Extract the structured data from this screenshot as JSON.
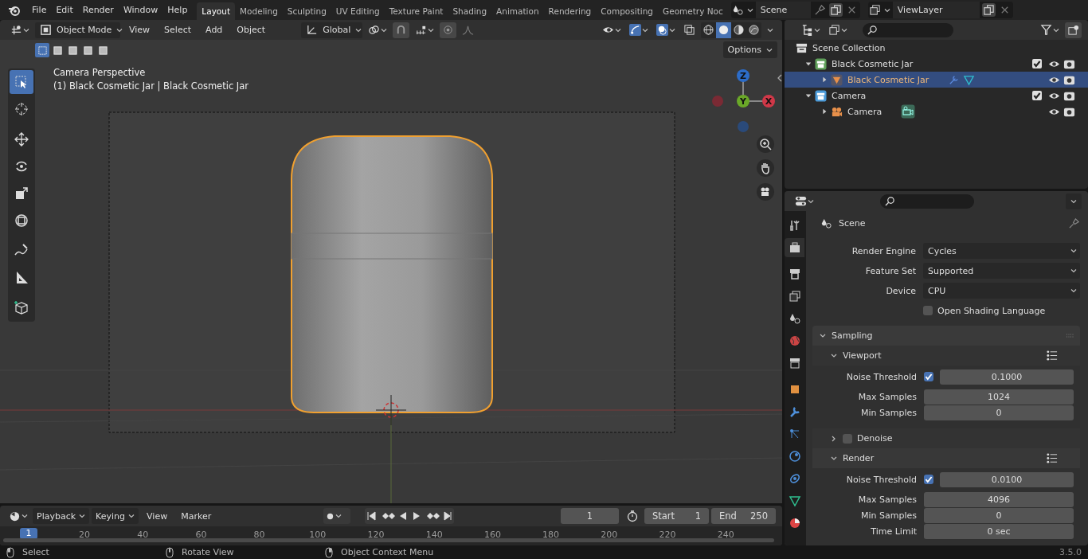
{
  "menu": [
    "File",
    "Edit",
    "Render",
    "Window",
    "Help"
  ],
  "workspaces": [
    {
      "label": "Layout",
      "selected": true
    },
    {
      "label": "Modeling",
      "selected": false
    },
    {
      "label": "Sculpting",
      "selected": false
    },
    {
      "label": "UV Editing",
      "selected": false
    },
    {
      "label": "Texture Paint",
      "selected": false
    },
    {
      "label": "Shading",
      "selected": false
    },
    {
      "label": "Animation",
      "selected": false
    },
    {
      "label": "Rendering",
      "selected": false
    },
    {
      "label": "Compositing",
      "selected": false
    },
    {
      "label": "Geometry Noc",
      "selected": false
    }
  ],
  "scene": "Scene",
  "view_layer": "ViewLayer",
  "viewport_header": {
    "mode": "Object Mode",
    "menus": [
      "View",
      "Select",
      "Add",
      "Object"
    ],
    "orientation": "Global",
    "options": "Options",
    "shading": [
      {
        "kind": "wireframe",
        "selected": false
      },
      {
        "kind": "solid",
        "selected": true
      },
      {
        "kind": "material",
        "selected": false
      },
      {
        "kind": "rendered",
        "selected": false
      }
    ],
    "select_modes": [
      {
        "selected": true
      },
      {
        "selected": false
      },
      {
        "selected": false
      },
      {
        "selected": false
      },
      {
        "selected": false
      }
    ]
  },
  "viewport": {
    "title": "Camera Perspective",
    "subtitle": "(1) Black Cosmetic Jar | Black Cosmetic Jar",
    "axes": [
      "Z",
      "Y",
      "X"
    ],
    "tools": [
      {
        "kind": "select",
        "selected": true
      },
      {
        "kind": "cursor",
        "selected": false
      },
      {
        "kind": "move",
        "selected": false
      },
      {
        "kind": "rotate",
        "selected": false
      },
      {
        "kind": "scale",
        "selected": false
      },
      {
        "kind": "transform",
        "selected": false
      },
      {
        "kind": "annotate",
        "selected": false
      },
      {
        "kind": "measure",
        "selected": false
      },
      {
        "kind": "add_cube",
        "selected": false
      }
    ]
  },
  "outliner": {
    "root": "Scene Collection",
    "items": [
      {
        "label": "Black Cosmetic Jar",
        "kind": "collection",
        "color": "#5fa05a",
        "selected": false,
        "expanded": true,
        "checked": true,
        "children": [
          {
            "label": "Black Cosmetic Jar",
            "kind": "mesh",
            "selected": true,
            "expanded": false
          }
        ]
      },
      {
        "label": "Camera",
        "kind": "collection",
        "color": "#4a9ad8",
        "selected": false,
        "expanded": true,
        "checked": true,
        "children": [
          {
            "label": "Camera",
            "kind": "camera",
            "selected": false,
            "expanded": false
          }
        ]
      }
    ]
  },
  "properties": {
    "tabs": [
      {
        "kind": "tool",
        "selected": false
      },
      {
        "kind": "render",
        "selected": true
      },
      {
        "kind": "output",
        "selected": false
      },
      {
        "kind": "view_layer",
        "selected": false
      },
      {
        "kind": "scene",
        "selected": false
      },
      {
        "kind": "world",
        "selected": false
      },
      {
        "kind": "collection",
        "selected": false
      },
      {
        "kind": "object",
        "selected": false
      },
      {
        "kind": "modifier",
        "selected": false
      },
      {
        "kind": "particles",
        "selected": false
      },
      {
        "kind": "physics",
        "selected": false
      },
      {
        "kind": "constraints",
        "selected": false
      },
      {
        "kind": "data",
        "selected": false
      },
      {
        "kind": "material",
        "selected": false
      }
    ],
    "context": "Scene",
    "fields": [
      {
        "kind": "dropdown",
        "label": "Render Engine",
        "value": "Cycles"
      },
      {
        "kind": "dropdown",
        "label": "Feature Set",
        "value": "Supported"
      },
      {
        "kind": "dropdown",
        "label": "Device",
        "value": "CPU"
      },
      {
        "kind": "checkbox",
        "label": "Open Shading Language",
        "checked": false
      }
    ],
    "panel": {
      "title": "Sampling",
      "expanded": true,
      "subpanels": [
        {
          "kind": "preset",
          "title": "Viewport",
          "expanded": true,
          "rows": [
            {
              "kind": "check_number",
              "label": "Noise Threshold",
              "checked": true,
              "value": "0.1000"
            },
            {
              "kind": "number",
              "label": "Max Samples",
              "value": "1024"
            },
            {
              "kind": "number",
              "label": "Min Samples",
              "value": "0"
            }
          ]
        },
        {
          "kind": "toggle",
          "title": "Denoise",
          "expanded": false,
          "checked": false
        },
        {
          "kind": "preset",
          "title": "Render",
          "expanded": true,
          "rows": [
            {
              "kind": "check_number",
              "label": "Noise Threshold",
              "checked": true,
              "value": "0.0100"
            },
            {
              "kind": "number",
              "label": "Max Samples",
              "value": "4096"
            },
            {
              "kind": "number",
              "label": "Min Samples",
              "value": "0"
            },
            {
              "kind": "number",
              "label": "Time Limit",
              "value": "0 sec"
            }
          ]
        }
      ]
    }
  },
  "timeline": {
    "menus": [
      {
        "kind": "dropdown",
        "label": "Playback"
      },
      {
        "kind": "dropdown",
        "label": "Keying"
      },
      {
        "kind": "menu",
        "label": "View"
      },
      {
        "kind": "menu",
        "label": "Marker"
      }
    ],
    "frame": "1",
    "start_label": "Start",
    "start": "1",
    "end_label": "End",
    "end": "250",
    "current": "1",
    "ticks": [
      "20",
      "40",
      "60",
      "80",
      "100",
      "120",
      "140",
      "160",
      "180",
      "200",
      "220",
      "240"
    ]
  },
  "status_bar": {
    "hints": [
      "Select",
      "Rotate View",
      "Object Context Menu"
    ],
    "version": "3.5.0"
  }
}
